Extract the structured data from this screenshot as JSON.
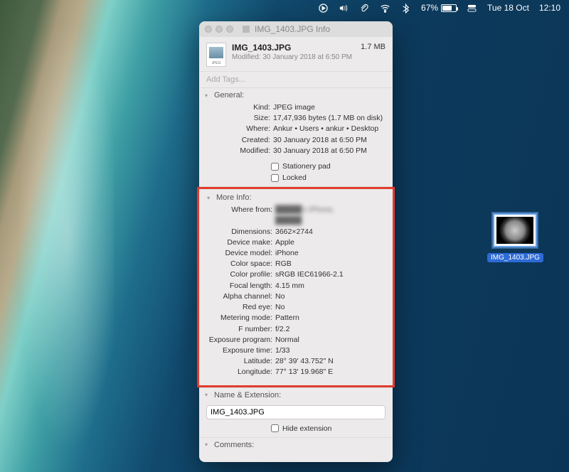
{
  "menubar": {
    "battery_pct": "67%",
    "date": "Tue 18 Oct",
    "time": "12:10"
  },
  "window": {
    "title": "IMG_1403.JPG Info",
    "filename": "IMG_1403.JPG",
    "filesize": "1.7 MB",
    "modified_line": "Modified: 30 January 2018 at 6:50 PM",
    "tags_placeholder": "Add Tags..."
  },
  "general": {
    "heading": "General:",
    "kind_k": "Kind:",
    "kind_v": "JPEG image",
    "size_k": "Size:",
    "size_v": "17,47,936 bytes (1.7 MB on disk)",
    "where_k": "Where:",
    "where_v": "Ankur • Users • ankur • Desktop",
    "created_k": "Created:",
    "created_v": "30 January 2018 at 6:50 PM",
    "modified_k": "Modified:",
    "modified_v": "30 January 2018 at 6:50 PM",
    "stationery": "Stationery pad",
    "locked": "Locked"
  },
  "more": {
    "heading": "More Info:",
    "wherefrom_k": "Where from:",
    "wherefrom_v1": "█████'s iPhone,",
    "wherefrom_v2": "█████",
    "dims_k": "Dimensions:",
    "dims_v": "3662×2744",
    "make_k": "Device make:",
    "make_v": "Apple",
    "model_k": "Device model:",
    "model_v": "iPhone",
    "cspace_k": "Color space:",
    "cspace_v": "RGB",
    "cprofile_k": "Color profile:",
    "cprofile_v": "sRGB IEC61966-2.1",
    "focal_k": "Focal length:",
    "focal_v": "4.15 mm",
    "alpha_k": "Alpha channel:",
    "alpha_v": "No",
    "redeye_k": "Red eye:",
    "redeye_v": "No",
    "meter_k": "Metering mode:",
    "meter_v": "Pattern",
    "fnum_k": "F number:",
    "fnum_v": "f/2.2",
    "exprog_k": "Exposure program:",
    "exprog_v": "Normal",
    "exptime_k": "Exposure time:",
    "exptime_v": "1/33",
    "lat_k": "Latitude:",
    "lat_v": "28° 39' 43.752\" N",
    "lon_k": "Longitude:",
    "lon_v": "77° 13' 19.968\" E"
  },
  "nameext": {
    "heading": "Name & Extension:",
    "filename": "IMG_1403.JPG",
    "hide": "Hide extension"
  },
  "comments": {
    "heading": "Comments:"
  },
  "desktop": {
    "filename": "IMG_1403.JPG"
  }
}
